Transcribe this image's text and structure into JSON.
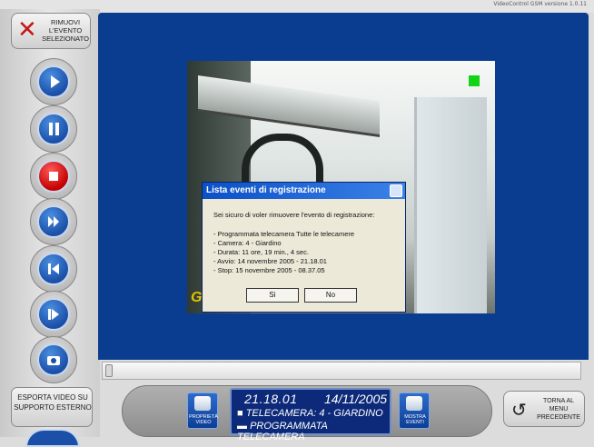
{
  "app": {
    "version": "VideoControl GSM versione 1.0.11"
  },
  "remove_event": {
    "label": "Rimuovi l'evento selezionato"
  },
  "controls": [
    {
      "name": "play-button",
      "icon": "play-icon"
    },
    {
      "name": "pause-button",
      "icon": "pause-icon"
    },
    {
      "name": "stop-button",
      "icon": "stop-icon"
    },
    {
      "name": "fast-forward-button",
      "icon": "fast-forward-icon"
    },
    {
      "name": "step-back-button",
      "icon": "step-back-icon"
    },
    {
      "name": "step-forward-button",
      "icon": "step-forward-icon"
    },
    {
      "name": "snapshot-button",
      "icon": "camera-icon"
    }
  ],
  "export": {
    "label": "Esporta video su supporto esterno"
  },
  "dialog": {
    "title": "Lista eventi di registrazione",
    "message": "Sei sicuro di voler rimuovere l'evento di registrazione:",
    "lines": [
      "- Programmata telecamera Tutte le telecamere",
      "- Camera: 4 - Giardino",
      "- Durata: 11 ore, 19 min., 4 sec.",
      "- Avvio: 14 novembre 2005 - 21.18.01",
      "- Stop: 15 novembre 2005 - 08.37.05"
    ],
    "yes_label": "Sì",
    "no_label": "No"
  },
  "video": {
    "overlay_letter": "G"
  },
  "bottom": {
    "properties_label": "Proprietà video",
    "events_label": "Mostra eventi",
    "time": "21.18.01",
    "date": "14/11/2005",
    "camera": "TELECAMERA: 4 - GIARDINO",
    "program": "PROGRAMMATA TELECAMERA",
    "back_label": "Torna al menu precedente"
  },
  "colors": {
    "main_blue": "#0a3d8f",
    "stop_red": "#c40000",
    "record_green": "#13d313"
  }
}
